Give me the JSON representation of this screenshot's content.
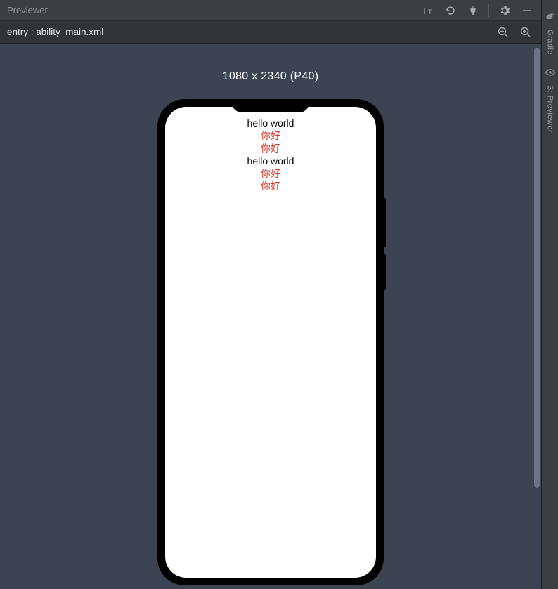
{
  "titlebar": {
    "title": "Previewer"
  },
  "filebar": {
    "path": "entry : ability_main.xml"
  },
  "canvas": {
    "dimension_label": "1080 x 2340 (P40)"
  },
  "phone": {
    "lines": [
      {
        "text": "hello world",
        "cls": ""
      },
      {
        "text": "你好",
        "cls": "red"
      },
      {
        "text": "你好",
        "cls": "red"
      },
      {
        "text": "hello world",
        "cls": ""
      },
      {
        "text": "你好",
        "cls": "red"
      },
      {
        "text": "你好",
        "cls": "red"
      }
    ]
  },
  "side_rail": {
    "gradle_label": "Gradle",
    "previewer_label": "3: Previewer"
  }
}
